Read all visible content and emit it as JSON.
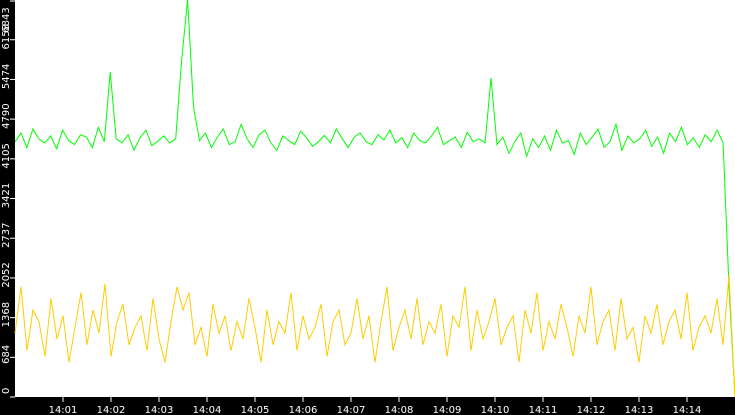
{
  "chart_data": {
    "type": "line",
    "title": "",
    "xlabel": "",
    "ylabel": "",
    "xlim": [
      0,
      15
    ],
    "ylim": [
      0,
      6843
    ],
    "x_unit": "minutes after 14:00",
    "x_ticks": [
      {
        "v": 1,
        "label": "14:01"
      },
      {
        "v": 2,
        "label": "14:02"
      },
      {
        "v": 3,
        "label": "14:03"
      },
      {
        "v": 4,
        "label": "14:04"
      },
      {
        "v": 5,
        "label": "14:05"
      },
      {
        "v": 6,
        "label": "14:06"
      },
      {
        "v": 7,
        "label": "14:07"
      },
      {
        "v": 8,
        "label": "14:08"
      },
      {
        "v": 9,
        "label": "14:09"
      },
      {
        "v": 10,
        "label": "14:10"
      },
      {
        "v": 11,
        "label": "14:11"
      },
      {
        "v": 12,
        "label": "14:12"
      },
      {
        "v": 13,
        "label": "14:13"
      },
      {
        "v": 14,
        "label": "14:14"
      }
    ],
    "y_ticks": [
      {
        "v": 0,
        "label": "0"
      },
      {
        "v": 684,
        "label": "684"
      },
      {
        "v": 1368,
        "label": "1368"
      },
      {
        "v": 2052,
        "label": "2052"
      },
      {
        "v": 2737,
        "label": "2737"
      },
      {
        "v": 3421,
        "label": "3421"
      },
      {
        "v": 4105,
        "label": "4105"
      },
      {
        "v": 4790,
        "label": "4790"
      },
      {
        "v": 5474,
        "label": "5474"
      },
      {
        "v": 6158,
        "label": "6158"
      },
      {
        "v": 6843,
        "label": "6843"
      }
    ],
    "grid": false,
    "series": [
      {
        "name": "green",
        "color": "#00ff00",
        "values": [
          4400,
          4550,
          4300,
          4620,
          4450,
          4380,
          4500,
          4280,
          4600,
          4420,
          4350,
          4520,
          4480,
          4300,
          4650,
          4400,
          5600,
          4450,
          4380,
          4520,
          4250,
          4470,
          4600,
          4330,
          4410,
          4500,
          4380,
          4450,
          5800,
          6843,
          5000,
          4420,
          4550,
          4300,
          4480,
          4620,
          4350,
          4400,
          4700,
          4450,
          4300,
          4520,
          4600,
          4380,
          4250,
          4500,
          4420,
          4350,
          4580,
          4470,
          4320,
          4400,
          4510,
          4380,
          4620,
          4450,
          4300,
          4480,
          4550,
          4400,
          4350,
          4520,
          4430,
          4600,
          4380,
          4470,
          4300,
          4550,
          4420,
          4380,
          4500,
          4650,
          4350,
          4420,
          4480,
          4300,
          4560,
          4400,
          4450,
          4380,
          5500,
          4350,
          4480,
          4200,
          4400,
          4550,
          4150,
          4450,
          4300,
          4500,
          4250,
          4600,
          4380,
          4420,
          4180,
          4550,
          4350,
          4480,
          4620,
          4300,
          4400,
          4700,
          4250,
          4500,
          4380,
          4450,
          4600,
          4320,
          4480,
          4200,
          4550,
          4400,
          4650,
          4350,
          4470,
          4300,
          4520,
          4400,
          4600,
          4380,
          1900,
          0
        ]
      },
      {
        "name": "yellow",
        "color": "#ffcc00",
        "values": [
          1100,
          1900,
          800,
          1500,
          1300,
          700,
          1700,
          1000,
          1400,
          600,
          1200,
          1800,
          900,
          1500,
          1100,
          1950,
          700,
          1300,
          1600,
          900,
          1200,
          1400,
          800,
          1700,
          1000,
          600,
          1300,
          1900,
          1500,
          1800,
          900,
          1200,
          700,
          1600,
          1100,
          1400,
          800,
          1300,
          1000,
          1700,
          1200,
          600,
          1500,
          900,
          1300,
          1100,
          1800,
          800,
          1400,
          1000,
          1200,
          1600,
          700,
          1300,
          1500,
          900,
          1100,
          1700,
          1000,
          1400,
          600,
          1300,
          1900,
          800,
          1200,
          1500,
          1000,
          1700,
          900,
          1300,
          1100,
          1600,
          700,
          1400,
          1200,
          1900,
          800,
          1500,
          1000,
          1300,
          1700,
          900,
          1200,
          1400,
          600,
          1500,
          1100,
          1800,
          800,
          1300,
          1000,
          1600,
          1200,
          700,
          1400,
          1100,
          1900,
          900,
          1300,
          1500,
          800,
          1700,
          1000,
          1200,
          600,
          1400,
          1100,
          1600,
          900,
          1300,
          1500,
          1000,
          1800,
          800,
          1200,
          1400,
          1100,
          1700,
          900,
          2100,
          0
        ]
      }
    ]
  }
}
